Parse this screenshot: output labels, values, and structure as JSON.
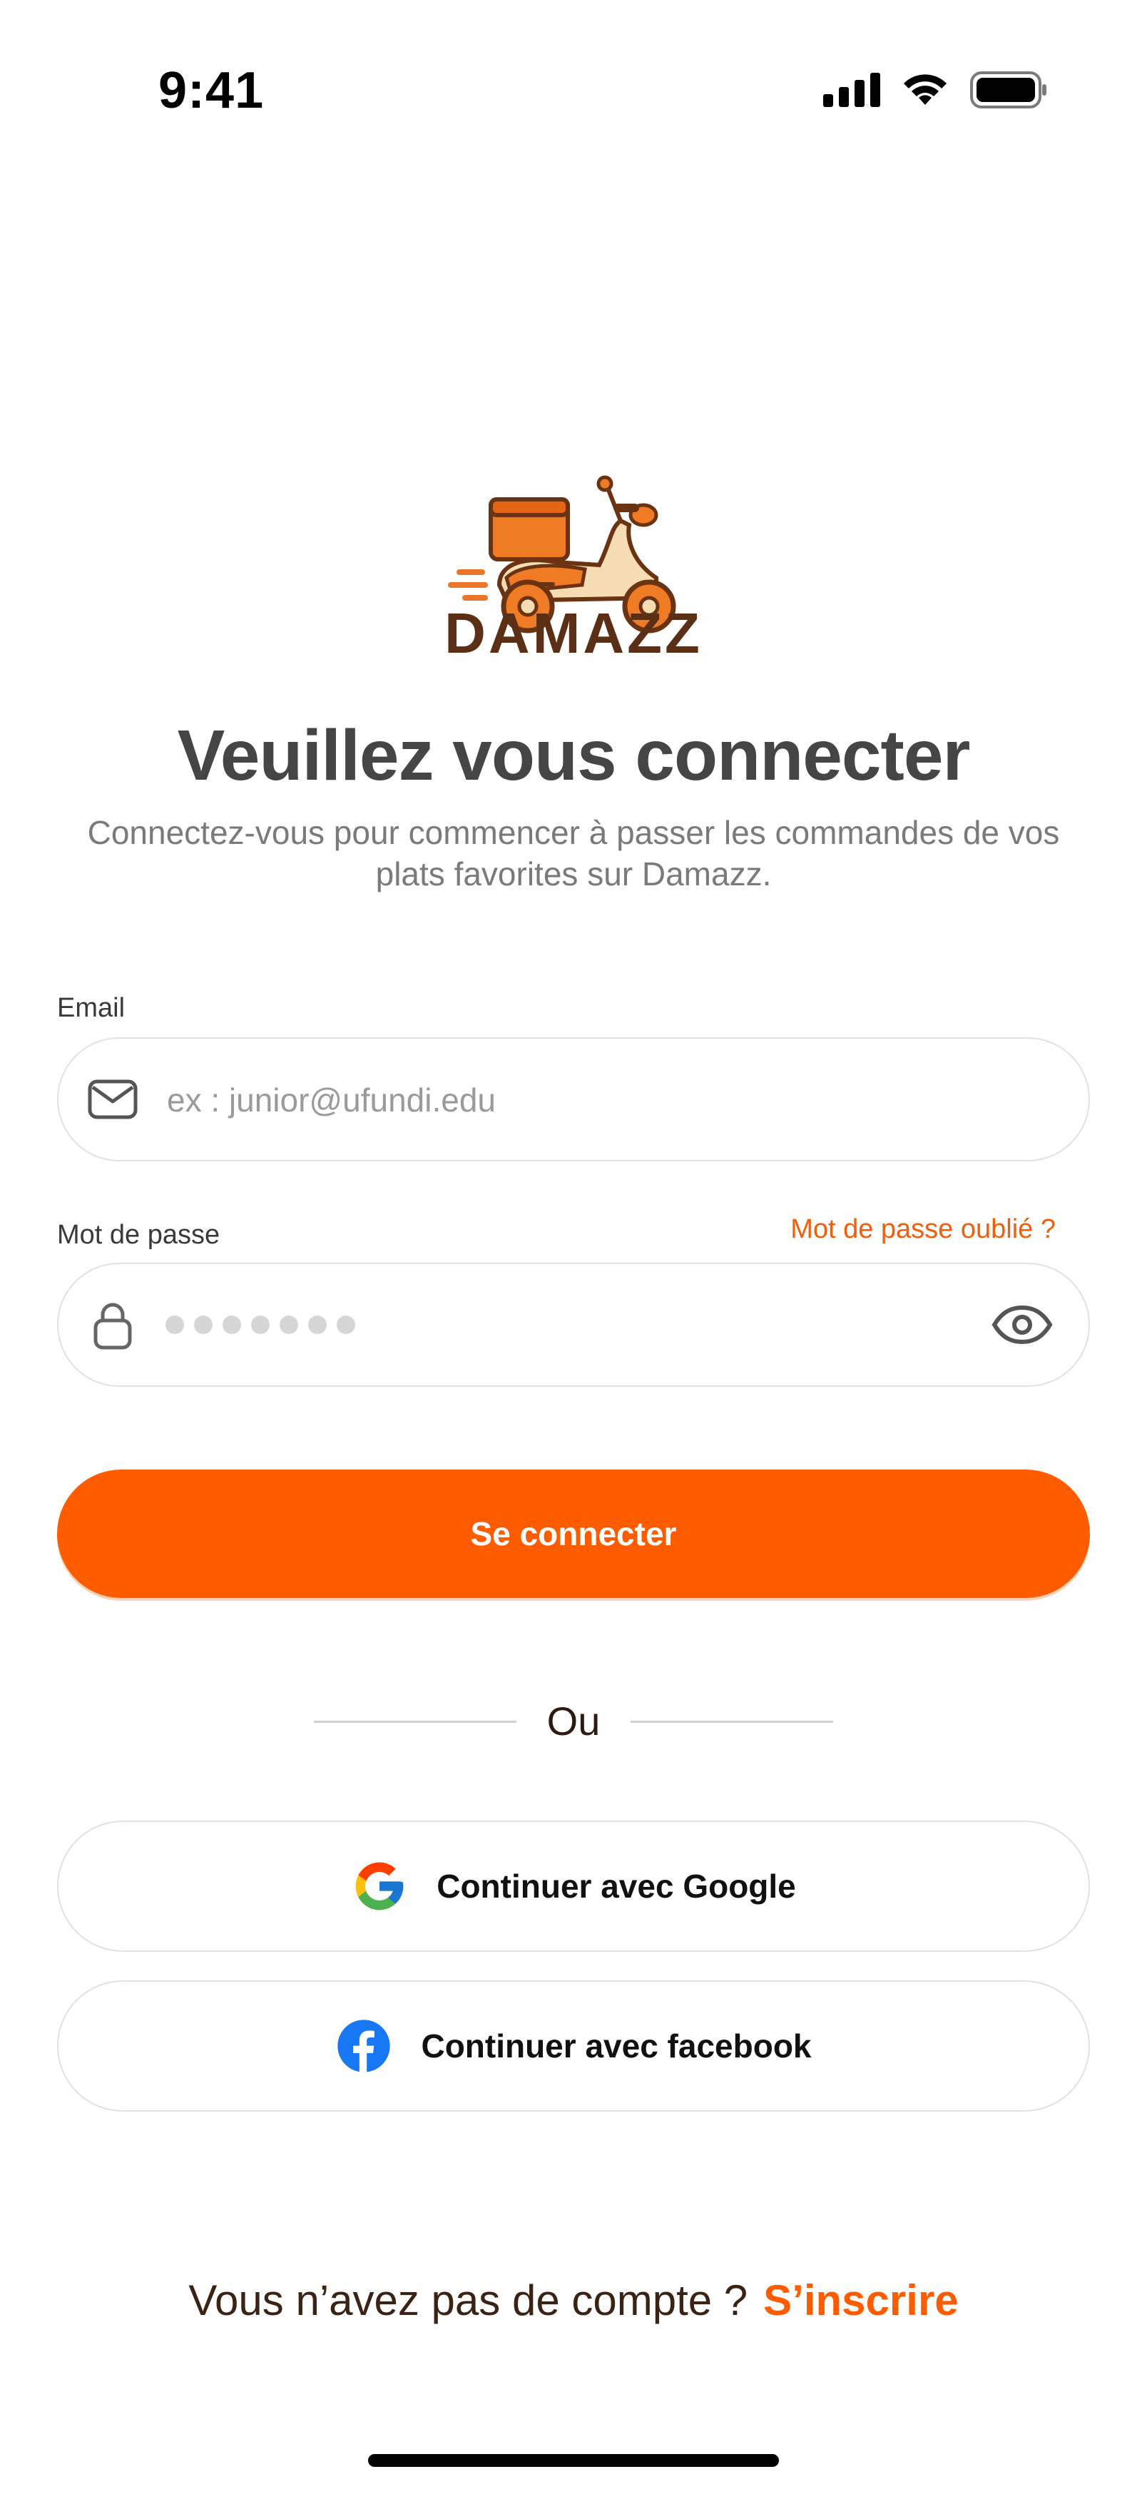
{
  "status_bar": {
    "time": "9:41"
  },
  "brand": {
    "name": "DAMAZZ",
    "primary_color": "#ff5c00",
    "brand_text_color": "#5a2f16"
  },
  "header": {
    "title": "Veuillez vous connecter",
    "subtitle": "Connectez-vous pour commencer à passer les commandes de vos plats favorites sur Damazz."
  },
  "form": {
    "email": {
      "label": "Email",
      "placeholder": "ex : junior@ufundi.edu",
      "icon": "mail-icon"
    },
    "password": {
      "label": "Mot de passe",
      "forgot_label": "Mot de passe oublié ?",
      "icon": "lock-icon",
      "toggle_icon": "eye-icon"
    },
    "submit_label": "Se connecter"
  },
  "divider": {
    "label": "Ou"
  },
  "social": {
    "google_label": "Continuer avec Google",
    "facebook_label": "Continuer avec facebook"
  },
  "footer": {
    "prompt": "Vous n’avez pas de compte ?",
    "signup_label": "S’inscrire"
  }
}
